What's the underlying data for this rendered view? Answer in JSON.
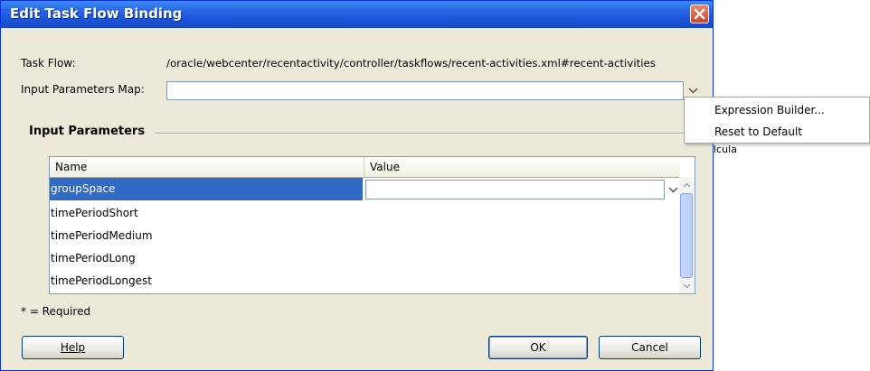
{
  "dialog": {
    "title": "Edit Task Flow Binding",
    "task_flow_label": "Task Flow:",
    "task_flow_value": "/oracle/webcenter/recentactivity/controller/taskflows/recent-activities.xml#recent-activities",
    "input_params_map_label": "Input Parameters Map:",
    "input_params_map_value": "",
    "section_title": "Input Parameters",
    "required_note": "* = Required"
  },
  "table": {
    "columns": [
      "Name",
      "Value"
    ],
    "rows": [
      {
        "name": "groupSpace",
        "value": ""
      },
      {
        "name": "timePeriodShort",
        "value": ""
      },
      {
        "name": "timePeriodMedium",
        "value": ""
      },
      {
        "name": "timePeriodLong",
        "value": ""
      },
      {
        "name": "timePeriodLongest",
        "value": ""
      }
    ]
  },
  "buttons": {
    "help": "Help",
    "ok": "OK",
    "cancel": "Cancel"
  },
  "menu": {
    "items": [
      "Expression Builder...",
      "Reset to Default"
    ]
  },
  "stray_text": "lcula",
  "colors": {
    "titlebar": "#1f5fe0",
    "selection": "#316ac5",
    "dialog_bg": "#ece9d8",
    "close_button": "#d9573a"
  },
  "icons": [
    "close-icon",
    "chevron-down-icon",
    "scroll-up-icon",
    "scroll-down-icon"
  ]
}
